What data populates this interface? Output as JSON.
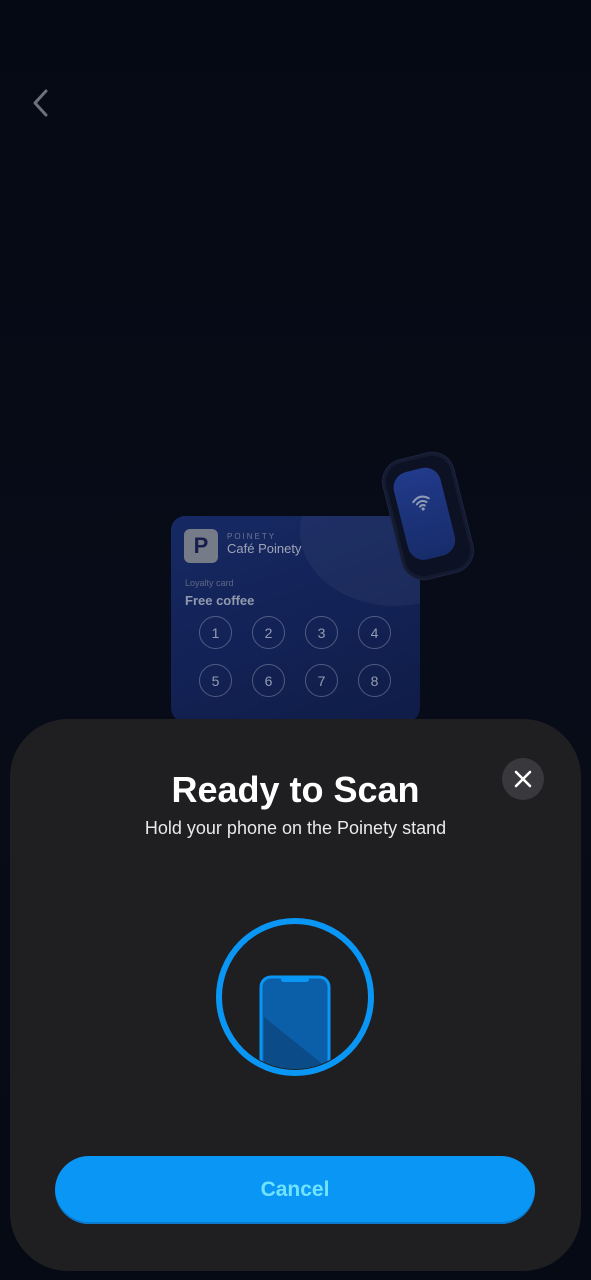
{
  "nav": {
    "back_icon": "chevron-left-icon"
  },
  "card": {
    "logo_letter": "P",
    "brand": "POINETY",
    "name": "Café Poinety",
    "type_label": "Loyalty card",
    "reward": "Free coffee",
    "stamps": [
      "1",
      "2",
      "3",
      "4",
      "5",
      "6",
      "7",
      "8"
    ]
  },
  "tag": {
    "icon": "nfc-wifi-icon"
  },
  "sheet": {
    "title": "Ready to Scan",
    "subtitle": "Hold your phone on the Poinety stand",
    "close_icon": "close-icon",
    "scan_icon": "phone-scan-icon",
    "cancel_label": "Cancel"
  },
  "colors": {
    "background": "#070b16",
    "sheet": "#1f1f22",
    "accent": "#0a96f5",
    "accent_text": "#6fe3ff",
    "card_blue": "#1a2f72"
  }
}
